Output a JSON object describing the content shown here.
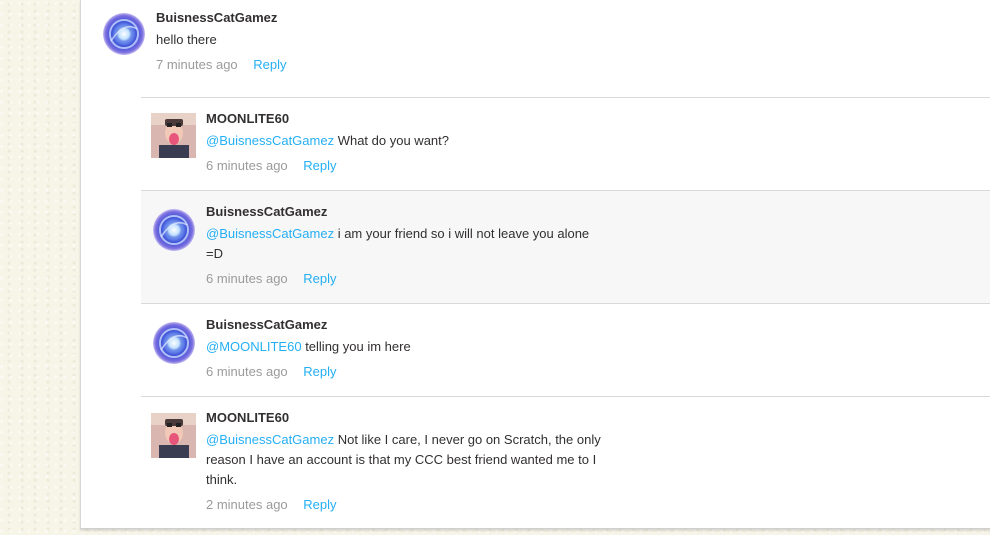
{
  "comments": [
    {
      "username": "BuisnessCatGamez",
      "mention": "",
      "text": "hello there",
      "time": "7 minutes ago",
      "reply_label": "Reply"
    },
    {
      "username": "MOONLITE60",
      "mention": "@BuisnessCatGamez",
      "text": "What do you want?",
      "time": "6 minutes ago",
      "reply_label": "Reply"
    },
    {
      "username": "BuisnessCatGamez",
      "mention": "@BuisnessCatGamez",
      "text": "i am your friend so i will not leave you alone =D",
      "time": "6 minutes ago",
      "reply_label": "Reply"
    },
    {
      "username": "BuisnessCatGamez",
      "mention": "@MOONLITE60",
      "text": "telling you im here",
      "time": "6 minutes ago",
      "reply_label": "Reply"
    },
    {
      "username": "MOONLITE60",
      "mention": "@BuisnessCatGamez",
      "text": "Not like I care, I never go on Scratch, the only reason I have an account is that my CCC best friend wanted me to I think.",
      "time": "2 minutes ago",
      "reply_label": "Reply"
    }
  ],
  "icons": {
    "orb_avatar": "glowing-orb-avatar-icon",
    "person_avatar": "person-avatar-icon"
  },
  "colors": {
    "link": "#25aff4",
    "muted": "#9b9b9b",
    "text": "#322f31",
    "highlight_bg": "#f7f7f7"
  }
}
